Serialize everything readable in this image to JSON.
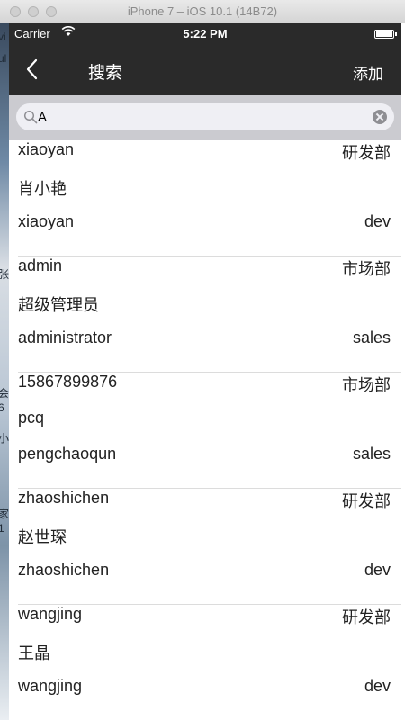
{
  "window": {
    "title": "iPhone 7 – iOS 10.1 (14B72)"
  },
  "desktop": {
    "fragments": [
      "vi",
      "ul",
      "张",
      "会",
      "6",
      "小",
      "家",
      "1"
    ]
  },
  "status_bar": {
    "carrier": "Carrier",
    "time": "5:22 PM"
  },
  "nav": {
    "title": "搜索",
    "add_label": "添加"
  },
  "search": {
    "value": "A"
  },
  "results": [
    {
      "id": "xiaoyan",
      "name": "肖小艳",
      "account": "xiaoyan",
      "department": "研发部",
      "role": "dev"
    },
    {
      "id": "admin",
      "name": "超级管理员",
      "account": "administrator",
      "department": "市场部",
      "role": "sales"
    },
    {
      "id": "15867899876",
      "name": "pcq",
      "account": "pengchaoqun",
      "department": "市场部",
      "role": "sales"
    },
    {
      "id": "zhaoshichen",
      "name": "赵世琛",
      "account": "zhaoshichen",
      "department": "研发部",
      "role": "dev"
    },
    {
      "id": "wangjing",
      "name": "王晶",
      "account": "wangjing",
      "department": "研发部",
      "role": "dev"
    }
  ]
}
